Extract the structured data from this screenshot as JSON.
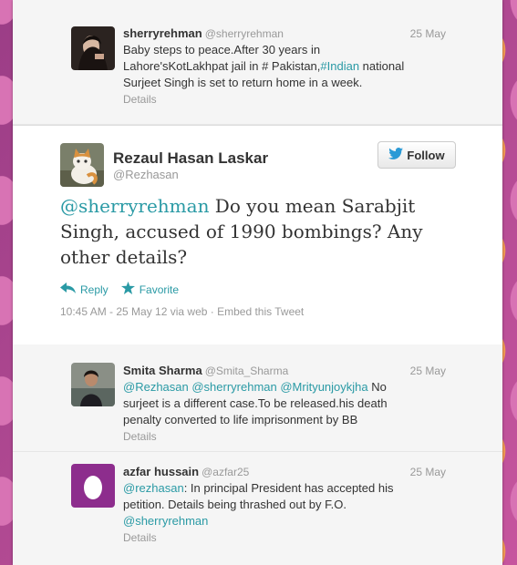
{
  "tweets_above": [
    {
      "name": "sherryrehman",
      "handle": "@sherryrehman",
      "date": "25 May",
      "text_before": "Baby steps to peace.After 30 years in Lahore'sKotLakhpat jail in # Pakistan,",
      "hashtag": "#Indian",
      "text_after": " national Surjeet Singh is set to return home in a week.",
      "details": "Details"
    }
  ],
  "main_tweet": {
    "name": "Rezaul Hasan Laskar",
    "handle": "@Rezhasan",
    "follow_label": "Follow",
    "mention": "@sherryrehman",
    "text": " Do you mean Sarabjit Singh, accused of 1990 bombings? Any other details?",
    "reply_label": "Reply",
    "favorite_label": "Favorite",
    "timestamp": "10:45 AM - 25 May 12 via web",
    "embed": "Embed this Tweet"
  },
  "replies": [
    {
      "name": "Smita Sharma",
      "handle": "@Smita_Sharma",
      "date": "25 May",
      "mentions": "@Rezhasan @sherryrehman @Mrityunjoykjha",
      "text": " No surjeet is a different case.To be released.his death penalty converted to life imprisonment by BB",
      "details": "Details"
    },
    {
      "name": "azfar hussain",
      "handle": "@azfar25",
      "date": "25 May",
      "mention1": "@rezhasan",
      "text": ": In principal President has accepted his petition. Details being thrashed out by F.O.",
      "mention2": "@sherryrehman",
      "details": "Details"
    }
  ],
  "colors": {
    "link": "#2a9aa5",
    "background": "#b5478f",
    "egg_avatar": "#8d2d8d"
  },
  "icons": [
    "twitter-bird-icon",
    "reply-arrow-icon",
    "favorite-star-icon",
    "egg-avatar-icon"
  ]
}
